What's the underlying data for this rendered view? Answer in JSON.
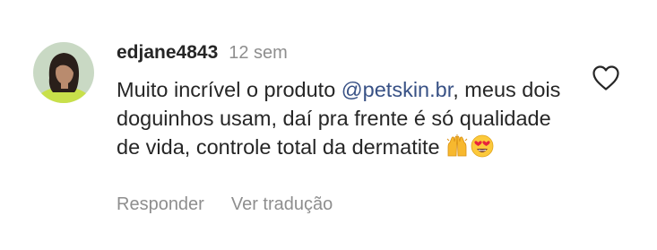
{
  "comment": {
    "username": "edjane4843",
    "timestamp": "12 sem",
    "text_before_mention": "Muito incrível o produto ",
    "mention": "@petskin.br",
    "text_after_mention": ", meus dois doguinhos usam, daí pra frente é só qualidade de vida, controle total da dermatite",
    "emojis": [
      "raising-hands-emoji",
      "heart-eyes-emoji"
    ],
    "like_icon": "heart-outline-icon"
  },
  "actions": {
    "reply_label": "Responder",
    "translate_label": "Ver tradução"
  },
  "colors": {
    "text": "#262626",
    "secondary": "#8e8e8e",
    "mention": "#385185"
  }
}
